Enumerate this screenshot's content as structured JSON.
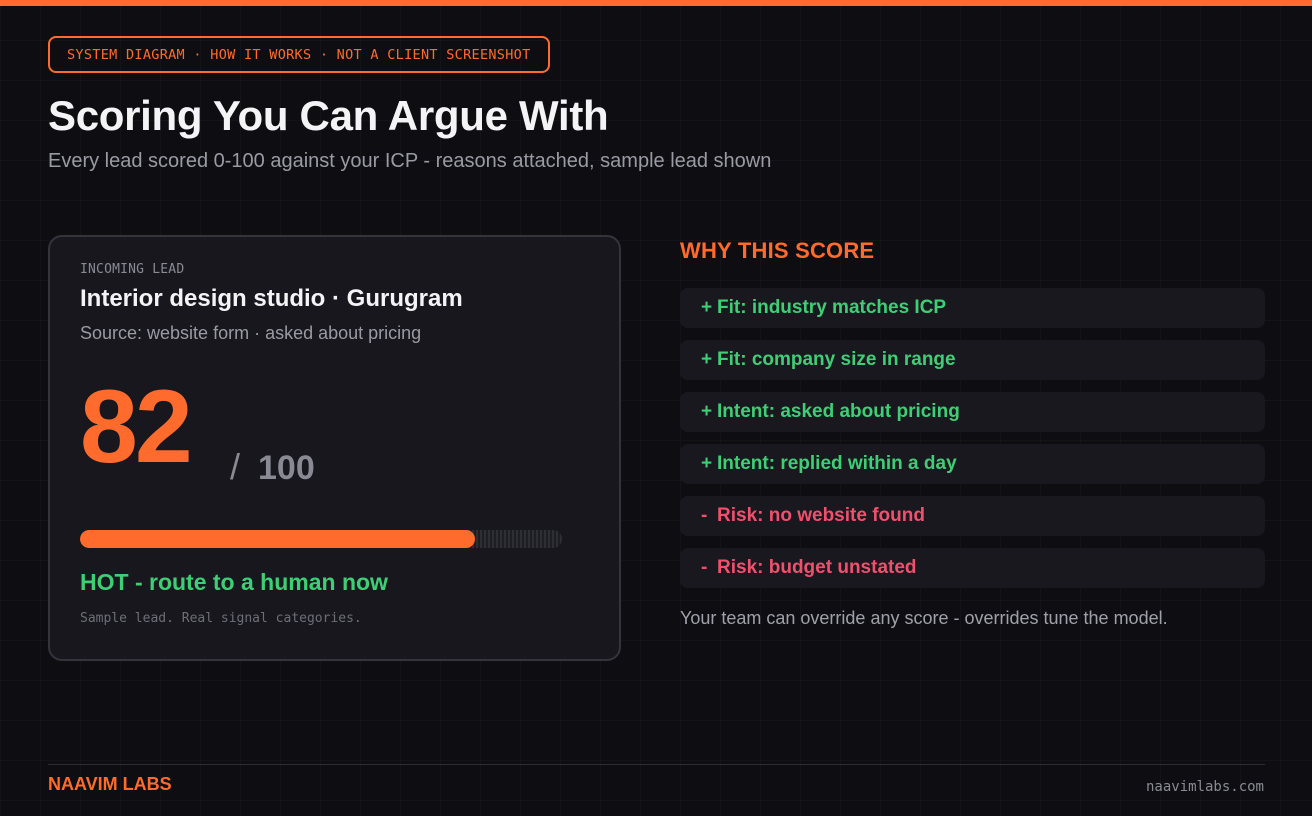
{
  "header": {
    "tag": "SYSTEM DIAGRAM · HOW IT WORKS · NOT A CLIENT SCREENSHOT",
    "title": "Scoring You Can Argue With",
    "subtitle": "Every lead scored 0-100 against your ICP - reasons attached, sample lead shown"
  },
  "lead": {
    "eyebrow": "INCOMING LEAD",
    "name": "Interior design studio · Gurugram",
    "source": "Source: website form · asked about pricing",
    "score": "82",
    "score_separator": "/",
    "score_max": "100",
    "score_fraction": 0.82,
    "verdict": "HOT - route to a human now",
    "note": "Sample lead. Real signal categories."
  },
  "why": {
    "heading": "WHY THIS SCORE",
    "reasons": [
      {
        "sign": "+",
        "text": "Fit: industry matches ICP",
        "polarity": "positive"
      },
      {
        "sign": "+",
        "text": "Fit: company size in range",
        "polarity": "positive"
      },
      {
        "sign": "+",
        "text": "Intent: asked about pricing",
        "polarity": "positive"
      },
      {
        "sign": "+",
        "text": "Intent: replied within a day",
        "polarity": "positive"
      },
      {
        "sign": "-",
        "text": "Risk: no website found",
        "polarity": "negative"
      },
      {
        "sign": "-",
        "text": "Risk: budget unstated",
        "polarity": "negative"
      }
    ],
    "footnote": "Your team can override any score - overrides tune the model."
  },
  "footer": {
    "brand": "NAAVIM LABS",
    "url": "naavimlabs.com"
  },
  "colors": {
    "accent": "#ff6b2c",
    "positive": "#3ecf76",
    "negative": "#f0506e",
    "background": "#0e0e12",
    "card": "#17171d"
  }
}
